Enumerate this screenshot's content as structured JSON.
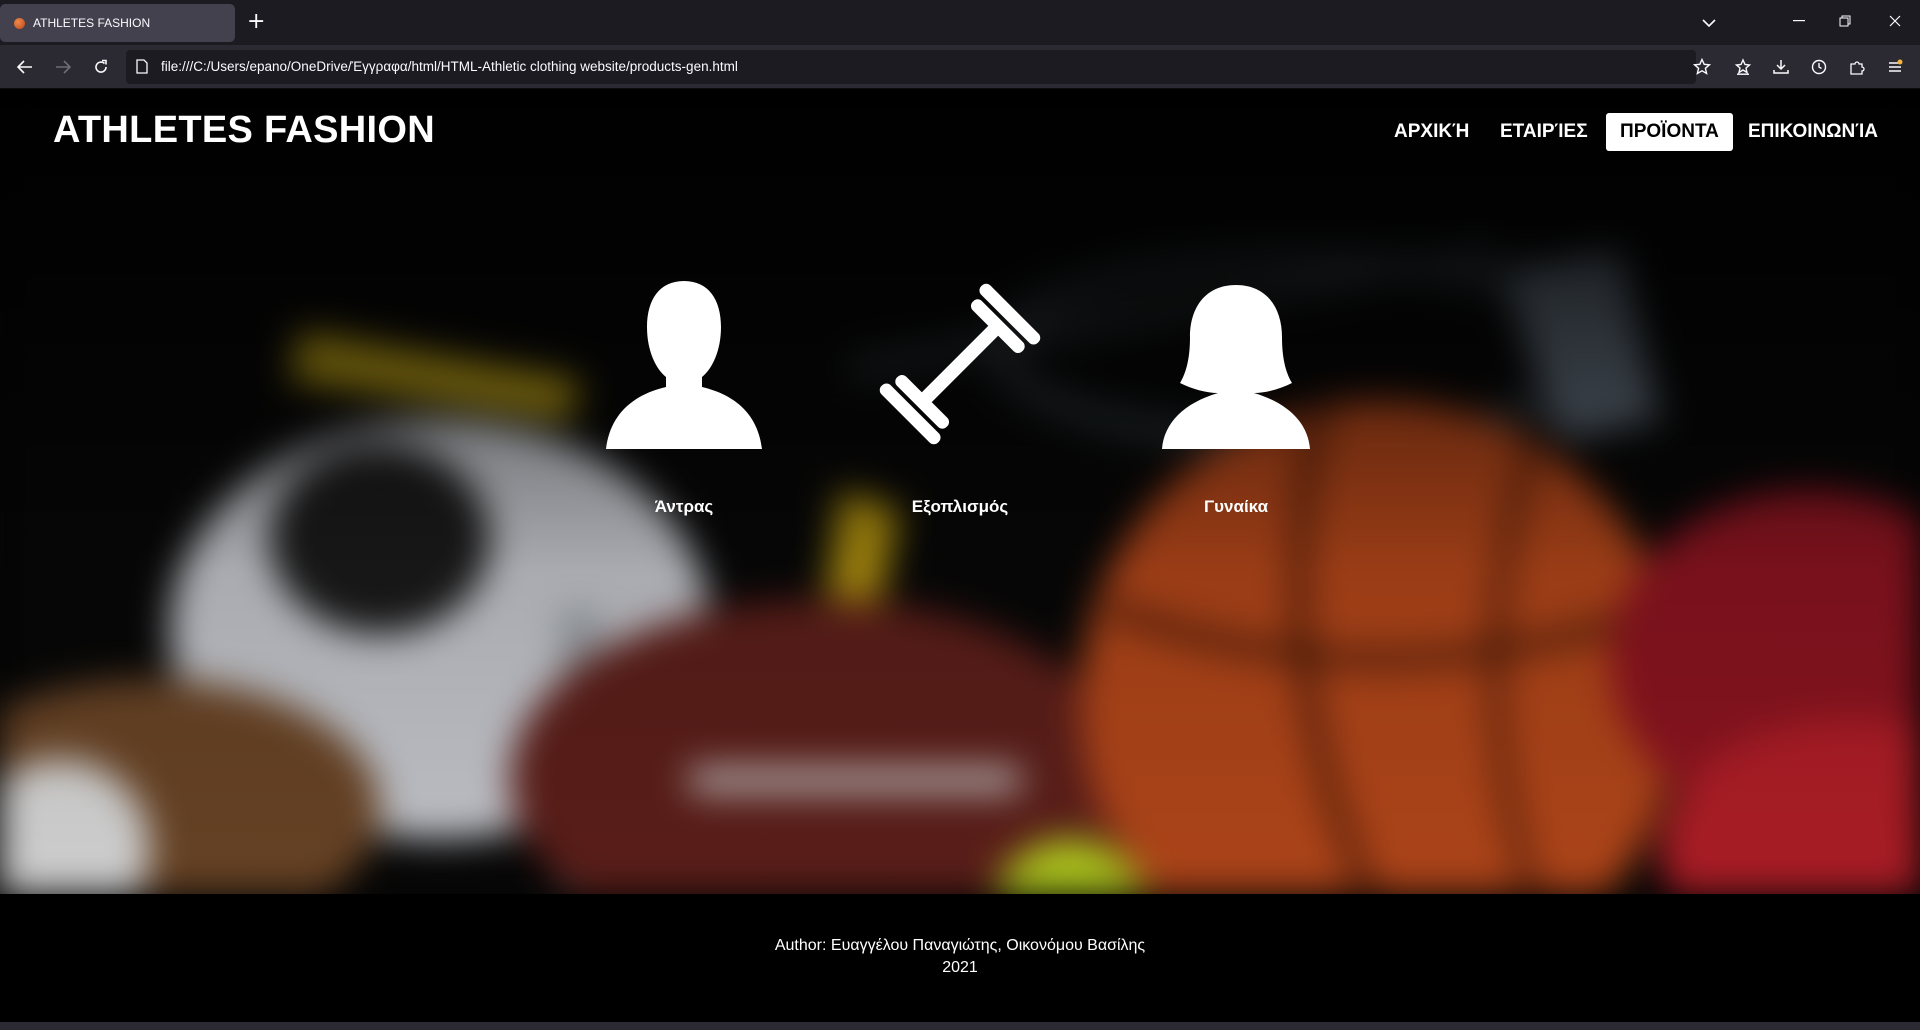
{
  "browser": {
    "tab": {
      "title": "ATHLETES FASHION",
      "favicon": "basketball-icon"
    },
    "url": "file:///C:/Users/epano/OneDrive/Έγγραφα/html/HTML-Athletic clothing website/products-gen.html"
  },
  "site": {
    "title": "ATHLETES FASHION",
    "nav": [
      {
        "label": "ΑΡΧΙΚΉ",
        "active": false
      },
      {
        "label": "ΕΤΑΙΡΊΕΣ",
        "active": false
      },
      {
        "label": "ΠΡΟΪΟΝΤΑ",
        "active": true
      },
      {
        "label": "ΕΠΙΚΟΙΝΩΝΊΑ",
        "active": false
      }
    ]
  },
  "categories": [
    {
      "label": "Άντρας",
      "icon": "man-icon"
    },
    {
      "label": "Εξοπλισμός",
      "icon": "dumbbell-icon"
    },
    {
      "label": "Γυναίκα",
      "icon": "woman-icon"
    }
  ],
  "footer": {
    "author": "Author: Ευαγγέλου Παναγιώτης, Οικονόμου Βασίλης",
    "year": "2021"
  },
  "colors": {
    "chrome_dark": "#1c1b22",
    "chrome": "#2b2a33",
    "active_nav_bg": "#ffffff",
    "text": "#ffffff"
  }
}
